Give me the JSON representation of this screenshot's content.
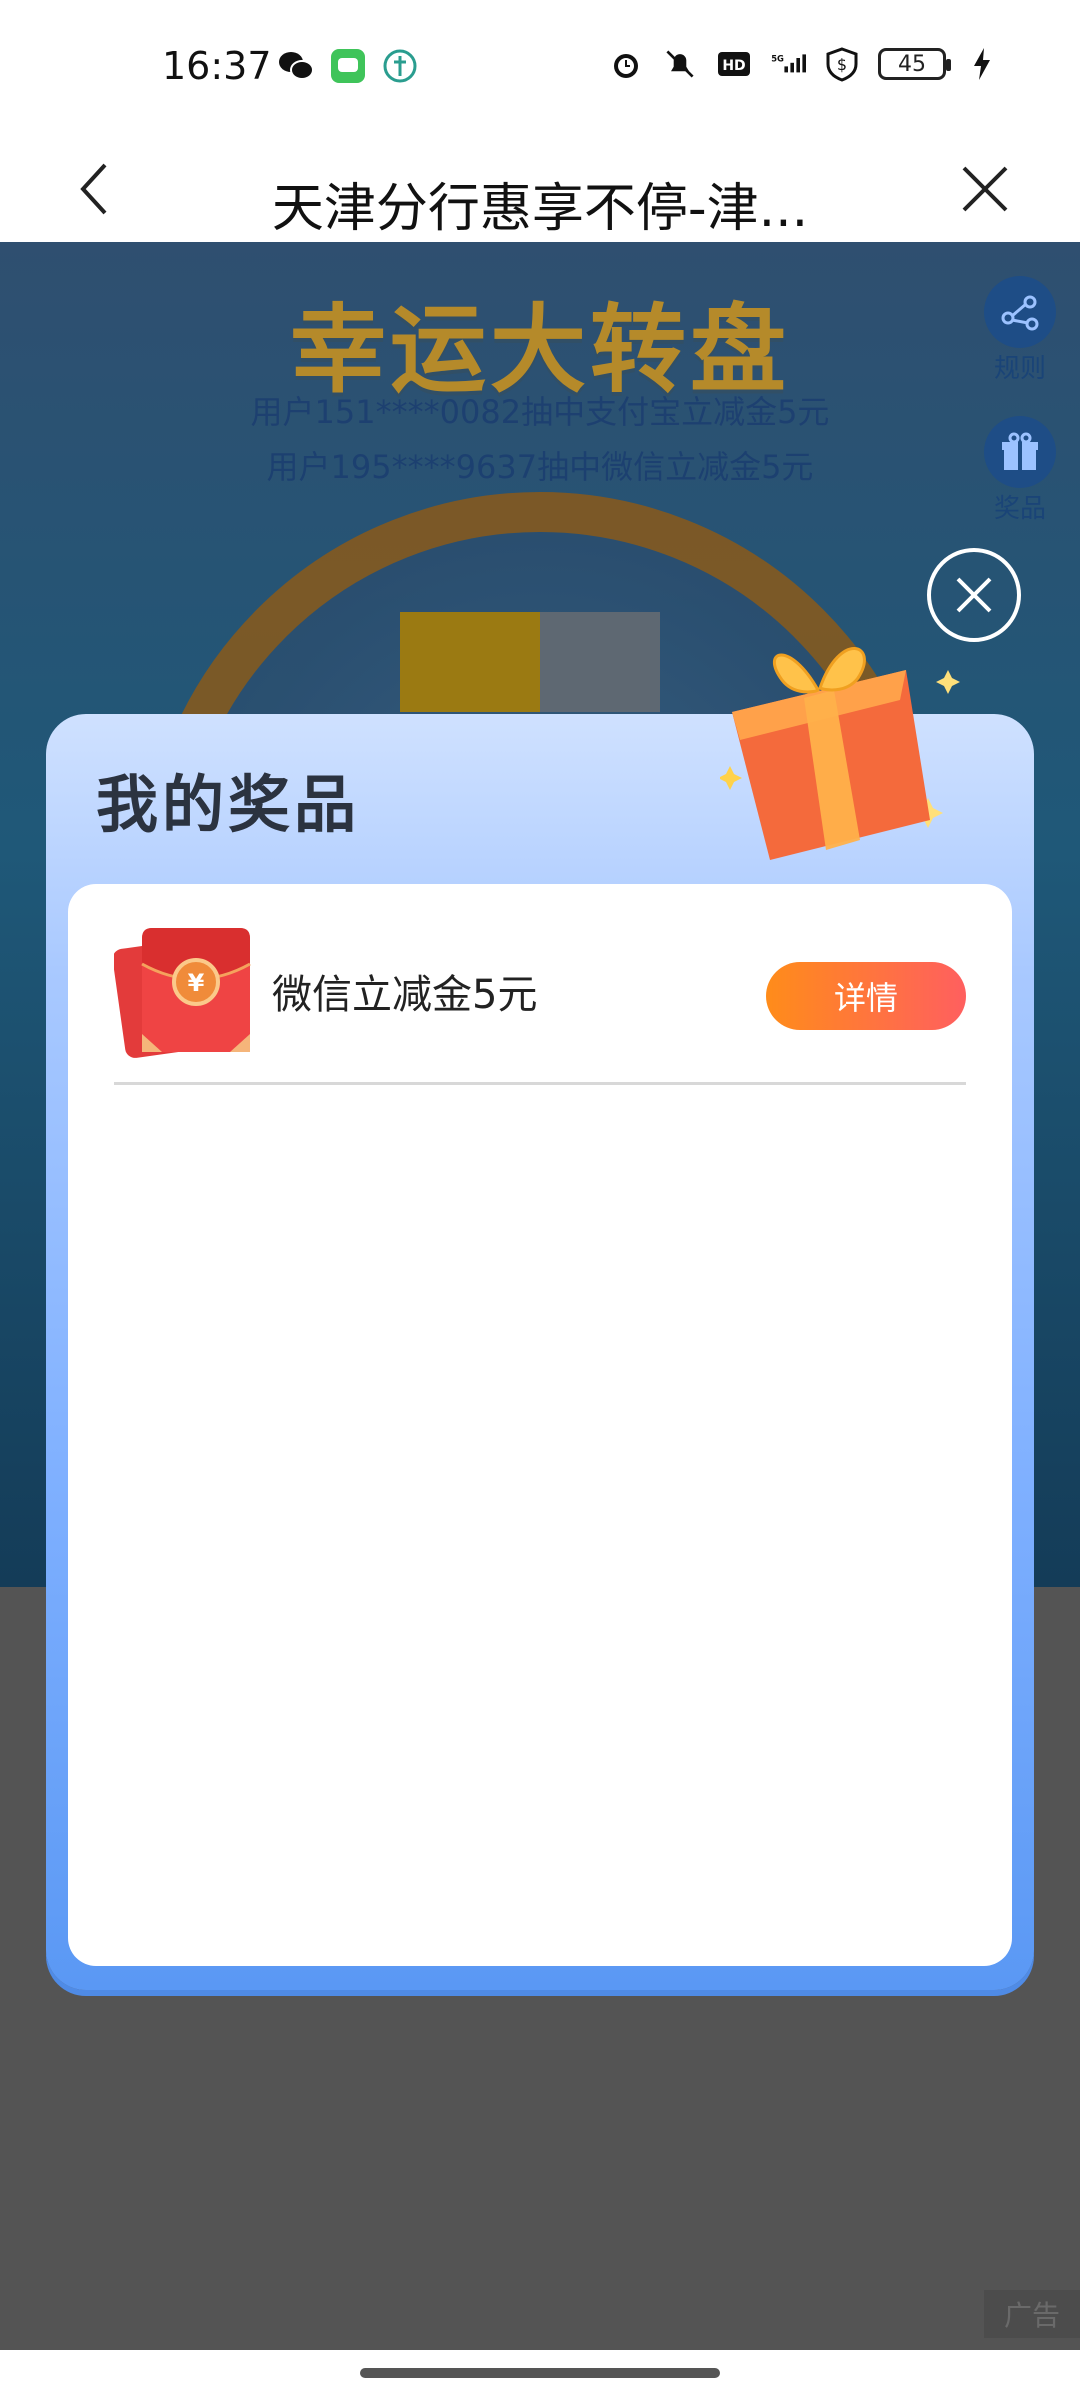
{
  "status_bar": {
    "time": "16:37",
    "battery": "45",
    "network": "5G",
    "hd_label": "HD"
  },
  "nav": {
    "title": "天津分行惠享不停-津..."
  },
  "background": {
    "game_title": "幸运大转盘",
    "marquee_line1": "用户151****0082抽中支付宝立减金5元",
    "marquee_line2": "用户195****9637抽中微信立减金5元",
    "rules_label": "规则",
    "prizes_label": "奖品",
    "ad_label": "广告"
  },
  "modal": {
    "title": "我的奖品",
    "prizes": [
      {
        "name": "微信立减金5元",
        "button_label": "详情",
        "icon": "red-envelope-icon",
        "icon_symbol": "¥"
      }
    ]
  },
  "colors": {
    "accent_orange": "#ff8c1a",
    "accent_pink": "#ff5f5f",
    "modal_blue": "#5a98f4"
  }
}
